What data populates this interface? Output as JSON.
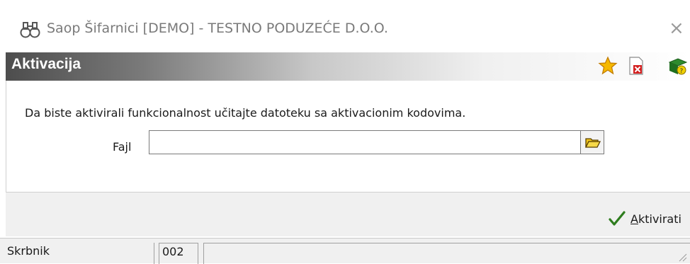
{
  "window": {
    "title": "Saop Šifarnici [DEMO] - TESTNO PODUZEĆE D.O.O.",
    "close_glyph": "×"
  },
  "header": {
    "title": "Aktivacija",
    "icons": [
      "star-icon",
      "close-document-icon",
      "help-book-icon"
    ]
  },
  "content": {
    "description": "Da biste aktivirali funkcionalnost učitajte datoteku sa aktivacionim kodovima.",
    "file_label": "Fajl",
    "file_value": ""
  },
  "footer": {
    "activate_underlined": "A",
    "activate_rest": "ktivirati"
  },
  "statusbar": {
    "user": "Skrbnik",
    "code": "002",
    "message": ""
  },
  "colors": {
    "check": "#2e7d1e",
    "folder": "#f0c419",
    "star": "#f5b800"
  }
}
